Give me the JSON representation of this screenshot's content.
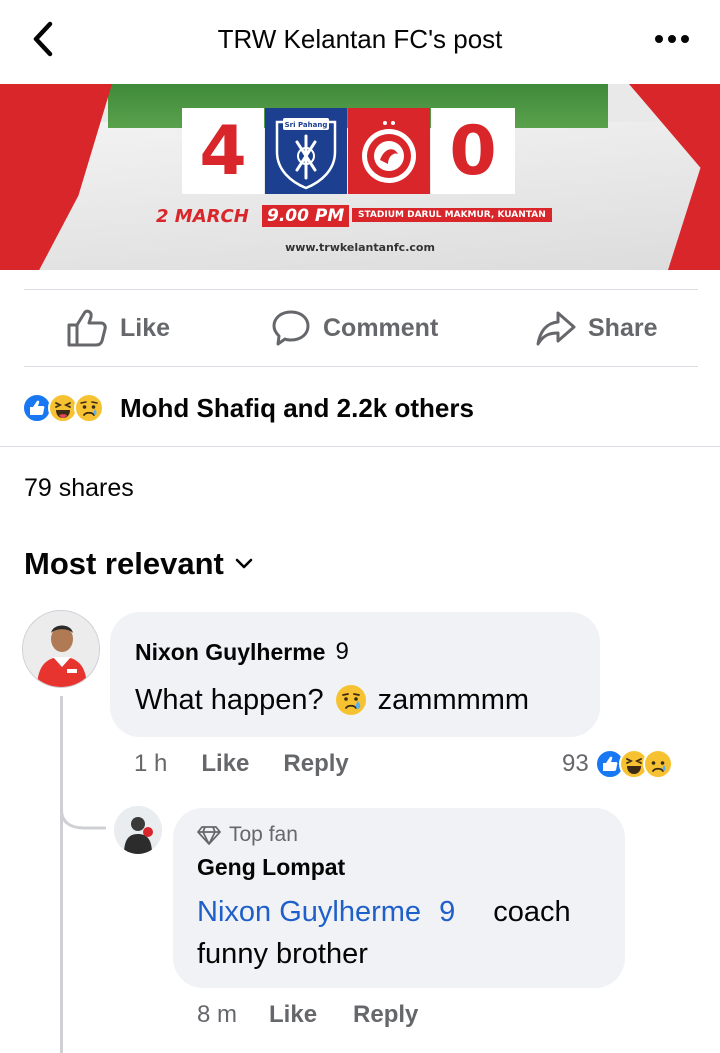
{
  "header": {
    "title": "TRW Kelantan FC's post",
    "back_icon": "chevron-left-icon",
    "more_icon": "more-dots-icon"
  },
  "post_image": {
    "score_home": "4",
    "score_away": "0",
    "home_crest_text": "Sri Pahang",
    "date": "2 MARCH",
    "time": "9.00 PM",
    "venue": "STADIUM DARUL MAKMUR, KUANTAN",
    "website": "www.trwkelantanfc.com"
  },
  "actions": {
    "like": "Like",
    "comment": "Comment",
    "share": "Share"
  },
  "reactions": {
    "summary": "Mohd Shafiq and 2.2k others",
    "icons": [
      "like-icon",
      "haha-icon",
      "sad-icon"
    ]
  },
  "shares": "79 shares",
  "sort_label": "Most relevant",
  "comments": [
    {
      "author": "Nixon Guylherme",
      "author_badge": "9",
      "text_before": "What happen?",
      "text_after": "zammmmm",
      "time": "1 h",
      "like": "Like",
      "reply": "Reply",
      "reaction_count": "93",
      "replies": [
        {
          "badge": "Top fan",
          "author": "Geng Lompat",
          "mention": "Nixon Guylherme",
          "mention_badge": "9",
          "text_line1": "coach",
          "text_line2": "funny brother",
          "time": "8 m",
          "like": "Like",
          "reply": "Reply"
        }
      ]
    }
  ],
  "colors": {
    "like_blue": "#1877f2",
    "mention_blue": "#1f5fc9",
    "meta_gray": "#65676b",
    "bubble_gray": "#f0f2f5",
    "club_red": "#d8262a",
    "opponent_navy": "#1c3f8f"
  }
}
